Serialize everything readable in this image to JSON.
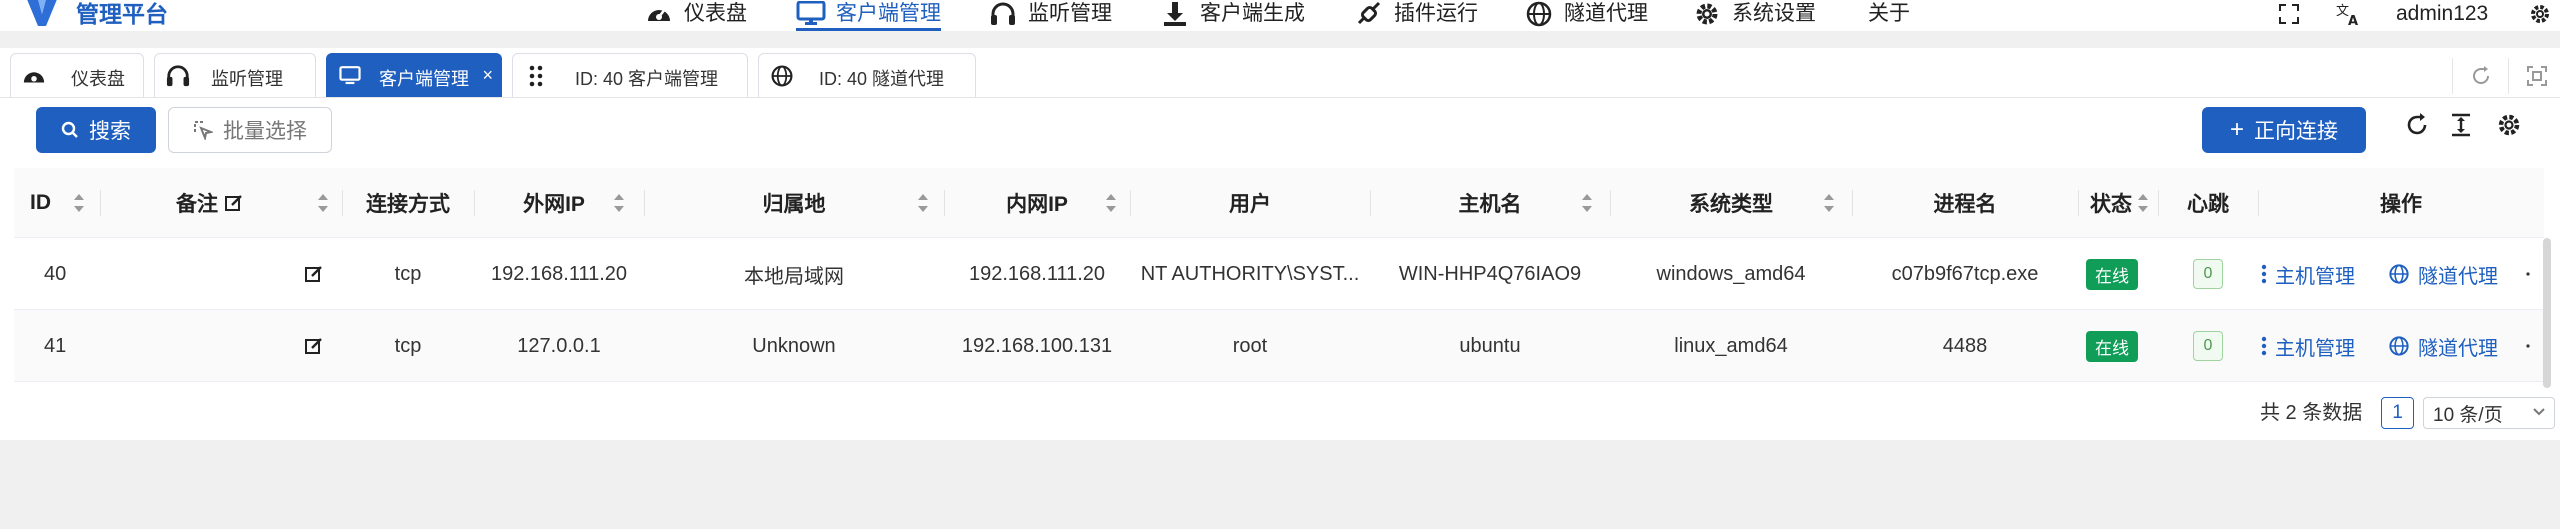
{
  "app": {
    "brand": "管理平台",
    "user": "admin123",
    "colors": {
      "primary": "#1f5fbf",
      "online": "#0f9d58"
    }
  },
  "menu": [
    {
      "label": "仪表盘",
      "icon": "dashboard-icon"
    },
    {
      "label": "客户端管理",
      "icon": "monitor-icon",
      "active": true
    },
    {
      "label": "监听管理",
      "icon": "headphones-icon"
    },
    {
      "label": "客户端生成",
      "icon": "download-icon"
    },
    {
      "label": "插件运行",
      "icon": "plug-icon"
    },
    {
      "label": "隧道代理",
      "icon": "globe-icon"
    },
    {
      "label": "系统设置",
      "icon": "gear-icon"
    },
    {
      "label": "关于",
      "icon": ""
    }
  ],
  "tabs": [
    {
      "label": "仪表盘",
      "icon": "dashboard-icon"
    },
    {
      "label": "监听管理",
      "icon": "headphones-icon"
    },
    {
      "label": "客户端管理",
      "icon": "monitor-icon",
      "active": true,
      "close": "×"
    },
    {
      "label": "ID: 40 客户端管理",
      "icon": "grip-icon"
    },
    {
      "label": "ID: 40 隧道代理",
      "icon": "globe-icon"
    }
  ],
  "toolbar": {
    "search_label": "搜索",
    "batch_label": "批量选择",
    "connect_label": "正向连接"
  },
  "table": {
    "columns": [
      "ID",
      "备注",
      "连接方式",
      "外网IP",
      "归属地",
      "内网IP",
      "用户",
      "主机名",
      "系统类型",
      "进程名",
      "状态",
      "心跳",
      "操作"
    ],
    "rows": [
      {
        "id": "40",
        "conn": "tcp",
        "wan_ip": "192.168.111.20",
        "location": "本地局域网",
        "lan_ip": "192.168.111.20",
        "user": "NT AUTHORITY\\SYST...",
        "hostname": "WIN-HHP4Q76IAO9",
        "os": "windows_amd64",
        "process": "c07b9f67tcp.exe",
        "status": "在线",
        "heartbeat": "0",
        "op1": "主机管理",
        "op2": "隧道代理"
      },
      {
        "id": "41",
        "conn": "tcp",
        "wan_ip": "127.0.0.1",
        "location": "Unknown",
        "lan_ip": "192.168.100.131",
        "user": "root",
        "hostname": "ubuntu",
        "os": "linux_amd64",
        "process": "4488",
        "status": "在线",
        "heartbeat": "0",
        "op1": "主机管理",
        "op2": "隧道代理"
      }
    ]
  },
  "pagination": {
    "total_text": "共 2 条数据",
    "current_page": "1",
    "page_size": "10 条/页"
  }
}
